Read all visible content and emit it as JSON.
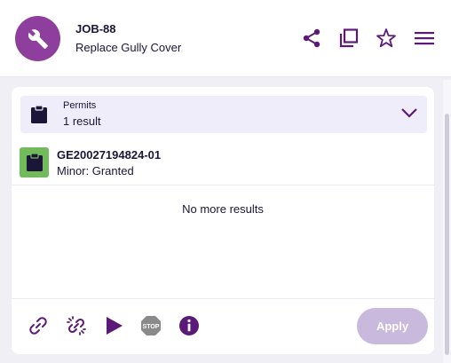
{
  "header": {
    "job_id": "JOB-88",
    "job_title": "Replace Gully Cover",
    "avatar_icon": "wrench-icon",
    "accent_color": "#8e3e9c",
    "actions": [
      {
        "icon": "share-icon"
      },
      {
        "icon": "copy-icon"
      },
      {
        "icon": "star-icon"
      },
      {
        "icon": "menu-icon"
      }
    ]
  },
  "permits": {
    "label": "Permits",
    "count": "1 result",
    "icon": "clipboard-icon",
    "expand_icon": "chevron-down-icon"
  },
  "results": [
    {
      "id": "GE20027194824-01",
      "status": "Minor: Granted",
      "icon": "clipboard-icon",
      "status_color": "#71bb5c"
    }
  ],
  "no_more_text": "No more results",
  "footer": {
    "tools": [
      {
        "icon": "link-icon"
      },
      {
        "icon": "unlink-icon"
      },
      {
        "icon": "play-icon"
      },
      {
        "icon": "stop-icon",
        "text": "STOP"
      },
      {
        "icon": "info-icon"
      }
    ],
    "apply_label": "Apply"
  }
}
